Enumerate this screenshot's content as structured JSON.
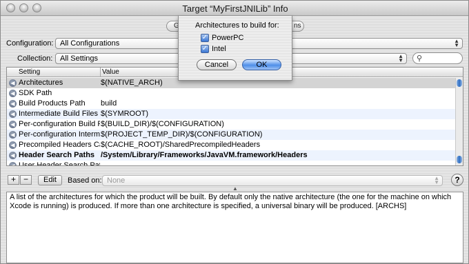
{
  "window": {
    "title": "Target “MyFirstJNILib” Info"
  },
  "tabs": {
    "left_visible": "Gen",
    "right_visible": "ns"
  },
  "configuration": {
    "label": "Configuration:",
    "value": "All Configurations"
  },
  "collection": {
    "label": "Collection:",
    "value": "All Settings"
  },
  "search": {
    "value": "",
    "icon": "search-icon"
  },
  "table": {
    "headers": {
      "setting": "Setting",
      "value": "Value"
    },
    "rows": [
      {
        "setting": "Architectures",
        "value": "$(NATIVE_ARCH)",
        "selected": true,
        "bold": false
      },
      {
        "setting": "SDK Path",
        "value": "",
        "selected": false,
        "bold": false
      },
      {
        "setting": "Build Products Path",
        "value": "build",
        "selected": false,
        "bold": false
      },
      {
        "setting": "Intermediate Build Files Pa",
        "value": "$(SYMROOT)",
        "selected": false,
        "bold": false
      },
      {
        "setting": "Per-configuration Build Pr",
        "value": "$(BUILD_DIR)/$(CONFIGURATION)",
        "selected": false,
        "bold": false
      },
      {
        "setting": "Per-configuration Interme",
        "value": "$(PROJECT_TEMP_DIR)/$(CONFIGURATION)",
        "selected": false,
        "bold": false
      },
      {
        "setting": "Precompiled Headers Cach",
        "value": "$(CACHE_ROOT)/SharedPrecompiledHeaders",
        "selected": false,
        "bold": false
      },
      {
        "setting": "Header Search Paths",
        "value": "/System/Library/Frameworks/JavaVM.framework/Headers",
        "selected": false,
        "bold": true
      },
      {
        "setting": "User Header Search Paths",
        "value": "",
        "selected": false,
        "bold": false
      }
    ]
  },
  "toolbar": {
    "add_label": "+",
    "remove_label": "−",
    "edit_label": "Edit",
    "based_on_label": "Based on:",
    "based_on_value": "None",
    "help_label": "?"
  },
  "description": "A list of the architectures for which the product will be built.  By default only the native architecture (the one for the machine on which Xcode is running) is produced.  If more than one architecture is specified, a universal binary will be produced. [ARCHS]",
  "sheet": {
    "title": "Architectures to build for:",
    "options": [
      {
        "label": "PowerPC",
        "checked": true
      },
      {
        "label": "Intel",
        "checked": true
      }
    ],
    "cancel_label": "Cancel",
    "ok_label": "OK"
  },
  "colors": {
    "selection": "#d4d4d4",
    "alt_row": "#edf3fe",
    "accent": "#3a77d4"
  }
}
